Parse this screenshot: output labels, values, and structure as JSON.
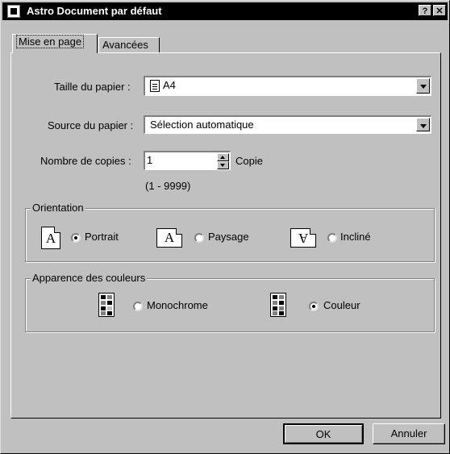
{
  "window": {
    "title": "Astro Document par défaut",
    "help_label": "?",
    "close_label": "✕"
  },
  "tabs": [
    {
      "label": "Mise en page",
      "selected": true
    },
    {
      "label": "Avancées",
      "selected": false
    }
  ],
  "paper_size": {
    "label": "Taille du papier :",
    "value": "A4",
    "icon": "document-icon"
  },
  "paper_source": {
    "label": "Source du papier :",
    "value": "Sélection automatique"
  },
  "copies": {
    "label": "Nombre de copies :",
    "value": "1",
    "unit": "Copie",
    "range": "(1 - 9999)"
  },
  "orientation": {
    "title": "Orientation",
    "options": [
      {
        "label": "Portrait",
        "selected": true,
        "icon": "portrait-icon"
      },
      {
        "label": "Paysage",
        "selected": false,
        "icon": "landscape-icon"
      },
      {
        "label": "Incliné",
        "selected": false,
        "icon": "rotated-icon"
      }
    ],
    "icon_glyph": "A"
  },
  "color": {
    "title": "Apparence des couleurs",
    "options": [
      {
        "label": "Monochrome",
        "selected": false,
        "icon": "monochrome-icon"
      },
      {
        "label": "Couleur",
        "selected": true,
        "icon": "color-icon"
      }
    ]
  },
  "buttons": {
    "ok": "OK",
    "cancel": "Annuler"
  }
}
